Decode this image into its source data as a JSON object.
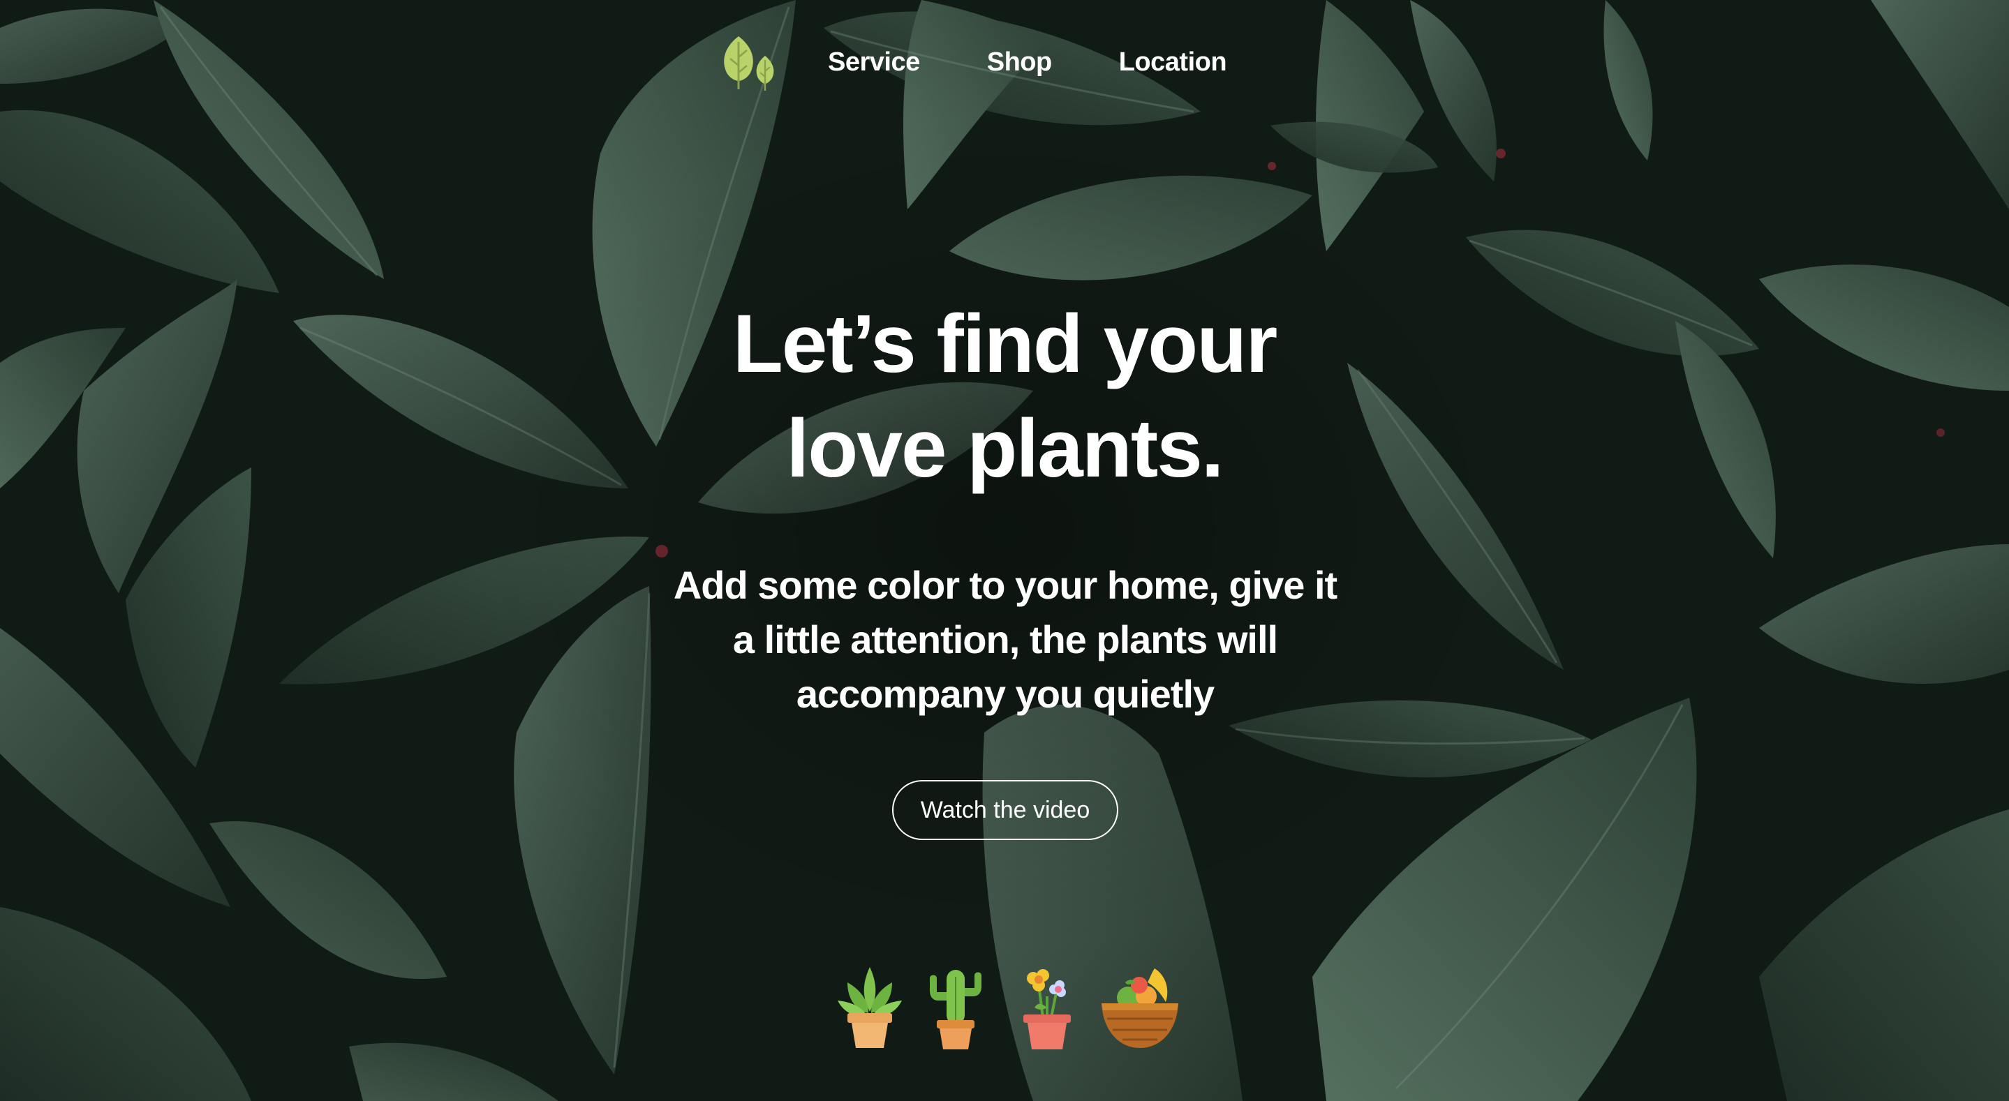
{
  "nav": {
    "logo_icon": "leaf-logo-icon",
    "links": [
      {
        "label": "Service"
      },
      {
        "label": "Shop"
      },
      {
        "label": "Location"
      }
    ]
  },
  "hero": {
    "title_line1": "Let’s find your",
    "title_line2": "love plants.",
    "subtitle_line1": "Add some color to your home, give it",
    "subtitle_line2": "a little attention, the plants will",
    "subtitle_line3": "accompany you quietly",
    "cta_label": "Watch the video"
  },
  "plants": [
    {
      "icon": "succulent-pot-icon"
    },
    {
      "icon": "cactus-pot-icon"
    },
    {
      "icon": "flower-pot-icon"
    },
    {
      "icon": "fruit-basket-icon"
    }
  ],
  "colors": {
    "background": "#0f1712",
    "leaf_dark": "#2a3b31",
    "leaf_mid": "#3f5447",
    "logo_green": "#b9d36a",
    "text": "#ffffff"
  }
}
